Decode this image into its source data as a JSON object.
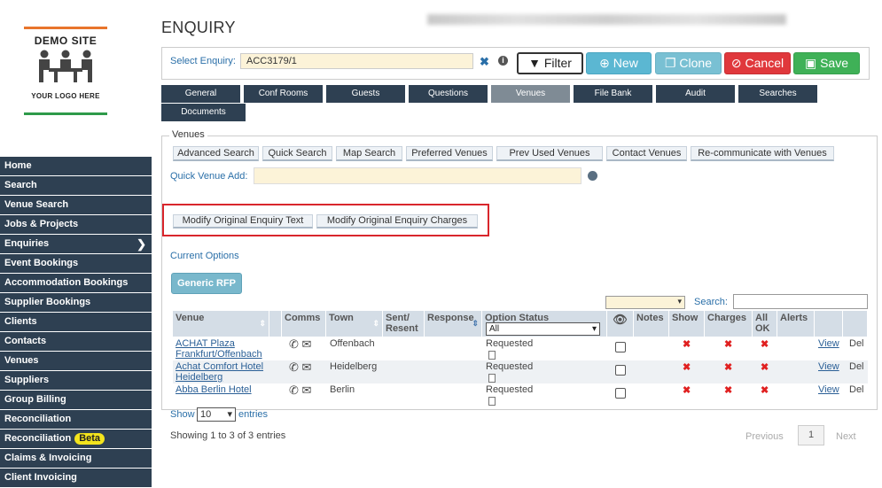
{
  "logo": {
    "title": "DEMO SITE",
    "subtitle": "YOUR LOGO HERE",
    "accent_top": "#e8752c",
    "accent_bottom": "#2e9a4a"
  },
  "sidebar": {
    "items": [
      {
        "label": "Home"
      },
      {
        "label": "Search"
      },
      {
        "label": "Venue Search"
      },
      {
        "label": "Jobs & Projects"
      },
      {
        "label": "Enquiries",
        "active": true
      },
      {
        "label": "Event Bookings"
      },
      {
        "label": "Accommodation Bookings"
      },
      {
        "label": "Supplier Bookings"
      },
      {
        "label": "Clients"
      },
      {
        "label": "Contacts"
      },
      {
        "label": "Venues"
      },
      {
        "label": "Suppliers"
      },
      {
        "label": "Group Billing"
      },
      {
        "label": "Reconciliation"
      },
      {
        "label": "Reconciliation",
        "badge": "Beta"
      },
      {
        "label": "Claims & Invoicing"
      },
      {
        "label": "Client Invoicing"
      }
    ]
  },
  "header": {
    "title": "ENQUIRY"
  },
  "enquiry": {
    "select_label": "Select Enquiry:",
    "select_value": "ACC3179/1",
    "buttons": {
      "filter": "Filter",
      "new": "New",
      "clone": "Clone",
      "cancel": "Cancel",
      "save": "Save"
    }
  },
  "tabs": [
    {
      "label": "General"
    },
    {
      "label": "Conf Rooms"
    },
    {
      "label": "Guests"
    },
    {
      "label": "Questions"
    },
    {
      "label": "Venues",
      "active": true
    },
    {
      "label": "File Bank"
    },
    {
      "label": "Audit"
    },
    {
      "label": "Searches"
    },
    {
      "label": "Documents"
    }
  ],
  "venues": {
    "legend": "Venues",
    "actions": [
      "Advanced Search",
      "Quick Search",
      "Map Search",
      "Preferred Venues",
      "Prev Used Venues",
      "Contact Venues",
      "Re-communicate with Venues"
    ],
    "quick_add_label": "Quick Venue Add:",
    "modify_buttons": [
      "Modify Original Enquiry Text",
      "Modify Original Enquiry Charges"
    ],
    "current_options": "Current Options",
    "generic_rfp": "Generic RFP",
    "search_label": "Search:",
    "columns": [
      "Venue",
      "Comms",
      "Town",
      "Sent/ Resent",
      "Response",
      "Option Status",
      "Notes",
      "Show",
      "Charges",
      "All OK",
      "Alerts"
    ],
    "option_status_filter": "All",
    "rows": [
      {
        "venue": "ACHAT Plaza Frankfurt/Offenbach",
        "town": "Offenbach",
        "status": "Requested",
        "view": "View",
        "del": "Del"
      },
      {
        "venue": "Achat Comfort Hotel Heidelberg",
        "town": "Heidelberg",
        "status": "Requested",
        "view": "View",
        "del": "Del"
      },
      {
        "venue": "Abba Berlin Hotel",
        "town": "Berlin",
        "status": "Requested",
        "view": "View",
        "del": "Del"
      }
    ],
    "show_label": "Show",
    "page_size": "10",
    "entries_label": "entries",
    "showing": "Showing 1 to 3 of 3 entries",
    "pagination": {
      "prev": "Previous",
      "page": "1",
      "next": "Next"
    }
  }
}
